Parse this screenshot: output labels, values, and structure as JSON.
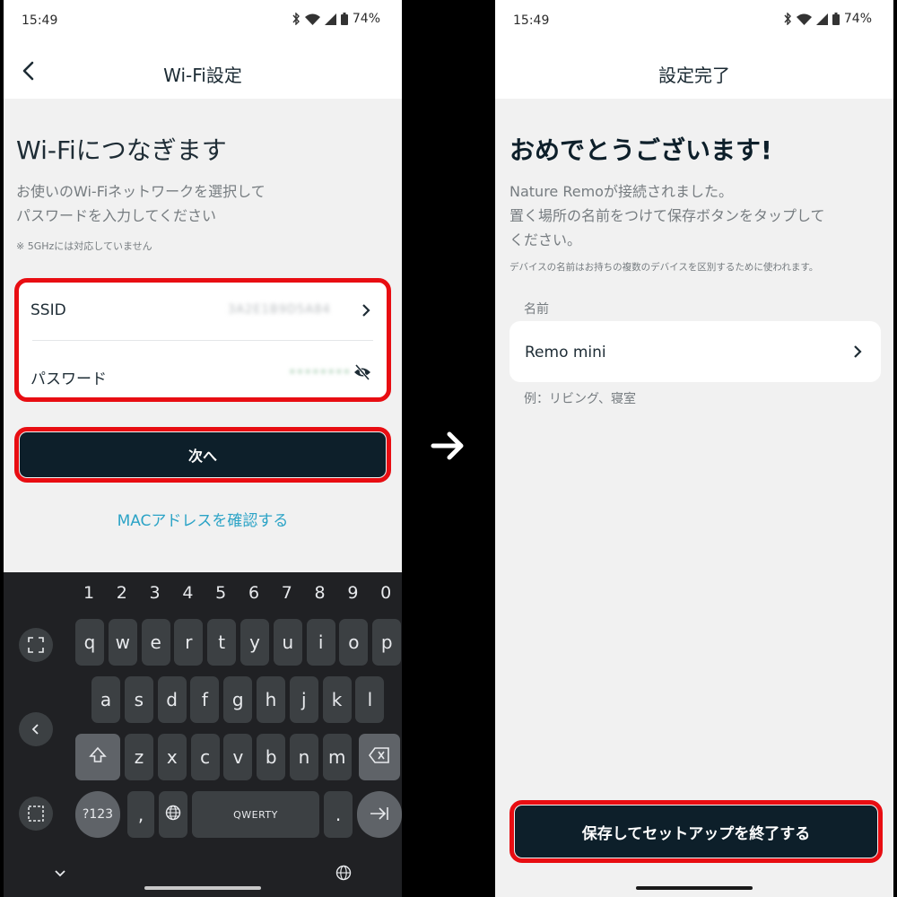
{
  "left": {
    "status_bar": {
      "time": "15:49",
      "battery": "74%"
    },
    "header": {
      "title": "Wi-Fi設定"
    },
    "heading": "Wi-Fiにつなぎます",
    "subtext_line1": "お使いのWi-Fiネットワークを選択して",
    "subtext_line2": "パスワードを入力してください",
    "note": "※ 5GHzには対応していません",
    "ssid": {
      "label": "SSID",
      "value": "3A2E1B9D5A84"
    },
    "password": {
      "label": "パスワード",
      "value": "••••••••"
    },
    "next_button": "次へ",
    "mac_link": "MACアドレスを確認する",
    "keyboard": {
      "numbers": [
        "1",
        "2",
        "3",
        "4",
        "5",
        "6",
        "7",
        "8",
        "9",
        "0"
      ],
      "row1": [
        "q",
        "w",
        "e",
        "r",
        "t",
        "y",
        "u",
        "i",
        "o",
        "p"
      ],
      "row2": [
        "a",
        "s",
        "d",
        "f",
        "g",
        "h",
        "j",
        "k",
        "l"
      ],
      "row3": [
        "z",
        "x",
        "c",
        "v",
        "b",
        "n",
        "m"
      ],
      "symbols_key": "?123",
      "comma_key": ",",
      "space_key": "QWERTY",
      "period_key": "."
    }
  },
  "right": {
    "status_bar": {
      "time": "15:49",
      "battery": "74%"
    },
    "header": {
      "title": "設定完了"
    },
    "congrats": "おめでとうございます!",
    "message_line1": "Nature Remoが接続されました。",
    "message_line2": "置く場所の名前をつけて保存ボタンをタップして",
    "message_line3": "ください。",
    "note": "デバイスの名前はお持ちの複数のデバイスを区別するために使われます。",
    "name_field": {
      "label": "名前",
      "value": "Remo mini",
      "example": "例：リビング、寝室"
    },
    "save_button": "保存してセットアップを終了する"
  },
  "colors": {
    "highlight": "#e80d12",
    "primary": "#0d1f2a",
    "link": "#2ba3c6",
    "keyboard_bg": "#202124",
    "key_bg": "#3c4043"
  }
}
